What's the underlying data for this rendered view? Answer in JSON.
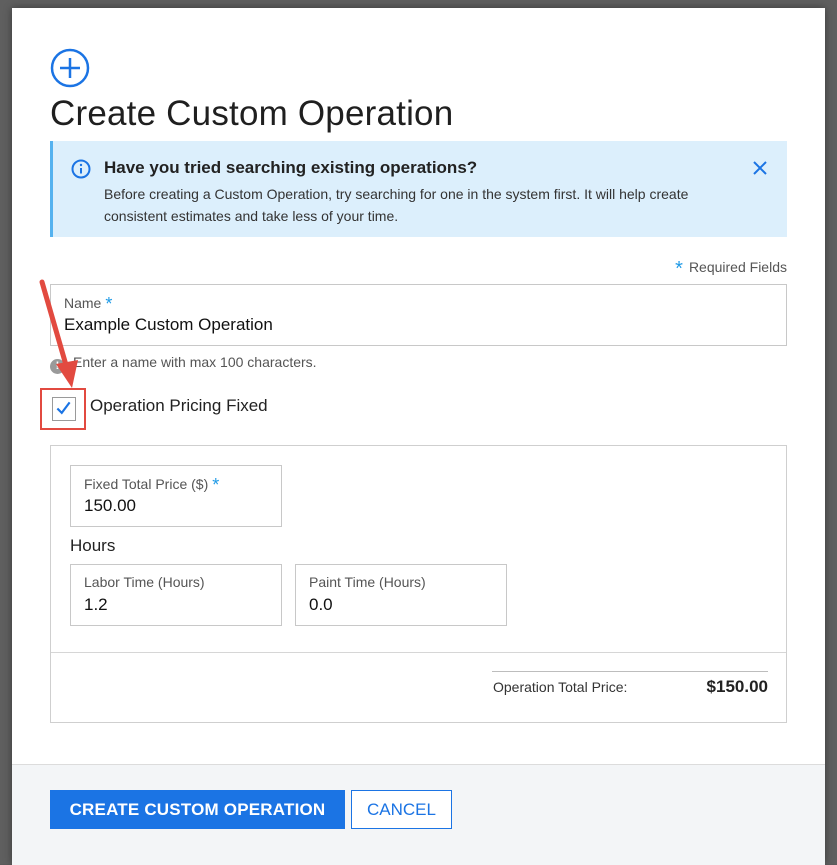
{
  "dialog": {
    "title": "Create Custom Operation",
    "info_banner": {
      "title": "Have you tried searching existing operations?",
      "text": "Before creating a Custom Operation, try searching for one in the system first. It will help create consistent estimates and take less of your time."
    },
    "required_note": "Required Fields",
    "name_field": {
      "label": "Name",
      "value": "Example Custom Operation",
      "hint": "Enter a name with max 100 characters."
    },
    "pricing_fixed_checkbox": {
      "label": "Operation Pricing Fixed",
      "checked": true
    },
    "pricing": {
      "fixed_total_price": {
        "label": "Fixed Total Price ($)",
        "value": "150.00"
      },
      "hours_heading": "Hours",
      "labor_time": {
        "label": "Labor Time (Hours)",
        "value": "1.2"
      },
      "paint_time": {
        "label": "Paint Time (Hours)",
        "value": "0.0"
      },
      "total_label": "Operation Total Price:",
      "total_value": "$150.00"
    },
    "buttons": {
      "create": "CREATE CUSTOM OPERATION",
      "cancel": "CANCEL"
    }
  },
  "colors": {
    "accent": "#1b74e4",
    "info_bg": "#dceffc",
    "required_star": "#1f9ae6",
    "highlight": "#e24a40"
  }
}
